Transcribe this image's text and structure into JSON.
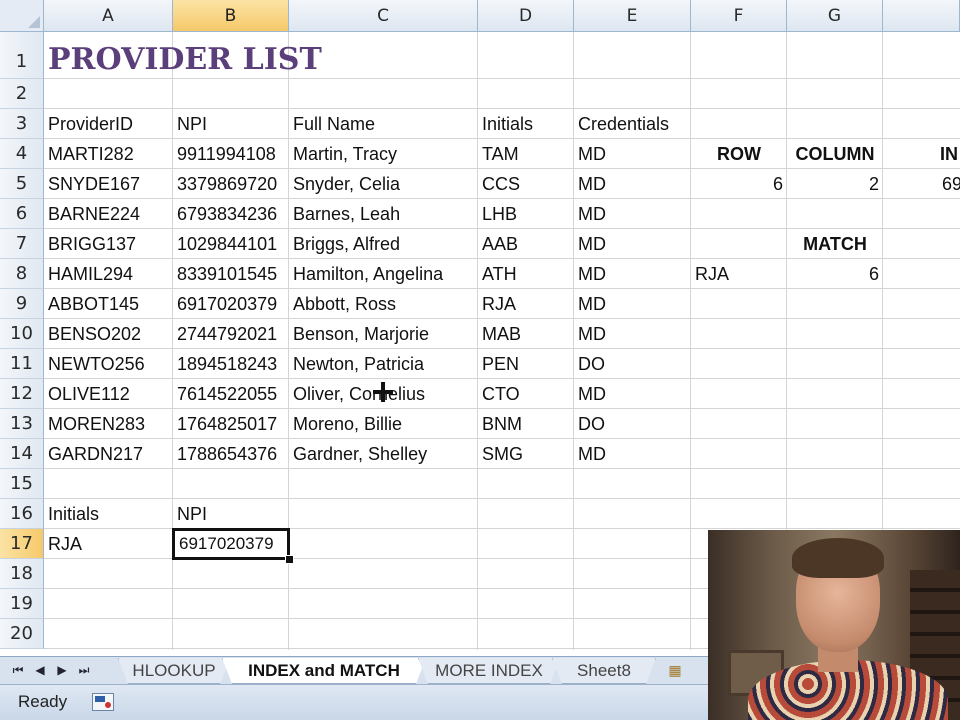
{
  "columns": [
    "A",
    "B",
    "C",
    "D",
    "E",
    "F",
    "G"
  ],
  "selected_column": "B",
  "selected_row": "17",
  "rows": [
    "1",
    "2",
    "3",
    "4",
    "5",
    "6",
    "7",
    "8",
    "9",
    "10",
    "11",
    "12",
    "13",
    "14",
    "15",
    "16",
    "17",
    "18",
    "19",
    "20"
  ],
  "title": "PROVIDER LIST",
  "headers": {
    "a": "ProviderID",
    "b": "NPI",
    "c": "Full Name",
    "d": "Initials",
    "e": "Credentials"
  },
  "providers": [
    {
      "id": "MARTI282",
      "npi": "9911994108",
      "name": "Martin, Tracy",
      "initials": "TAM",
      "cred": "MD"
    },
    {
      "id": "SNYDE167",
      "npi": "3379869720",
      "name": "Snyder, Celia",
      "initials": "CCS",
      "cred": "MD"
    },
    {
      "id": "BARNE224",
      "npi": "6793834236",
      "name": "Barnes, Leah",
      "initials": "LHB",
      "cred": "MD"
    },
    {
      "id": "BRIGG137",
      "npi": "1029844101",
      "name": "Briggs, Alfred",
      "initials": "AAB",
      "cred": "MD"
    },
    {
      "id": "HAMIL294",
      "npi": "8339101545",
      "name": "Hamilton, Angelina",
      "initials": "ATH",
      "cred": "MD"
    },
    {
      "id": "ABBOT145",
      "npi": "6917020379",
      "name": "Abbott, Ross",
      "initials": "RJA",
      "cred": "MD"
    },
    {
      "id": "BENSO202",
      "npi": "2744792021",
      "name": "Benson, Marjorie",
      "initials": "MAB",
      "cred": "MD"
    },
    {
      "id": "NEWTO256",
      "npi": "1894518243",
      "name": "Newton, Patricia",
      "initials": "PEN",
      "cred": "DO"
    },
    {
      "id": "OLIVE112",
      "npi": "7614522055",
      "name": "Oliver, Cornelius",
      "initials": "CTO",
      "cred": "MD"
    },
    {
      "id": "MOREN283",
      "npi": "1764825017",
      "name": "Moreno, Billie",
      "initials": "BNM",
      "cred": "DO"
    },
    {
      "id": "GARDN217",
      "npi": "1788654376",
      "name": "Gardner, Shelley",
      "initials": "SMG",
      "cred": "MD"
    }
  ],
  "side": {
    "row_label": "ROW",
    "column_label": "COLUMN",
    "index_label": "IN",
    "row_value": "6",
    "column_value": "2",
    "index_value": "69",
    "match_label": "MATCH",
    "match_key": "RJA",
    "match_value": "6"
  },
  "lookup": {
    "initials_label": "Initials",
    "npi_label": "NPI",
    "initials_value": "RJA",
    "npi_value": "6917020379"
  },
  "tabs": [
    {
      "label": "HLOOKUP"
    },
    {
      "label": "INDEX and MATCH"
    },
    {
      "label": "MORE INDEX"
    },
    {
      "label": "Sheet8"
    }
  ],
  "active_tab": "INDEX and MATCH",
  "status": {
    "ready": "Ready"
  },
  "colors": {
    "title": "#5b3f7a",
    "header_selected": "#f6c96a",
    "grid_header": "#dde6f1"
  }
}
